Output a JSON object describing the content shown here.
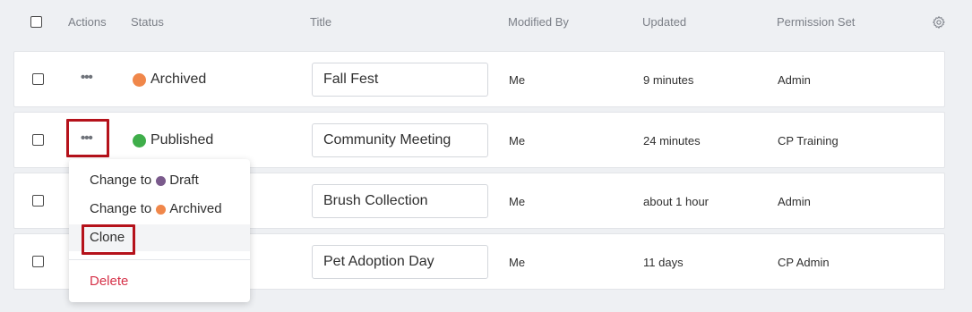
{
  "header": {
    "actions": "Actions",
    "status": "Status",
    "title": "Title",
    "modified_by": "Modified By",
    "updated": "Updated",
    "permission_set": "Permission Set"
  },
  "rows": [
    {
      "status": "Archived",
      "status_color": "#f0874a",
      "title": "Fall Fest",
      "modified_by": "Me",
      "updated": "9 minutes",
      "permission_set": "Admin"
    },
    {
      "status": "Published",
      "status_color": "#3fae4a",
      "title": "Community Meeting",
      "modified_by": "Me",
      "updated": "24 minutes",
      "permission_set": "CP Training"
    },
    {
      "status": "",
      "status_color": "",
      "title": "Brush Collection",
      "modified_by": "Me",
      "updated": "about 1 hour",
      "permission_set": "Admin"
    },
    {
      "status": "",
      "status_color": "",
      "title": "Pet Adoption Day",
      "modified_by": "Me",
      "updated": "11 days",
      "permission_set": "CP Admin"
    }
  ],
  "menu": {
    "change_to_draft_prefix": "Change to",
    "draft_label": "Draft",
    "draft_color": "#7a5a8c",
    "change_to_archived_prefix": "Change to",
    "archived_label": "Archived",
    "archived_color": "#f0874a",
    "clone_label": "Clone",
    "delete_label": "Delete"
  },
  "icons": {
    "actions_icon": "more-horizontal-icon",
    "settings_icon": "gear-icon"
  },
  "colors": {
    "highlight": "#b5121b",
    "danger": "#d6334a"
  }
}
